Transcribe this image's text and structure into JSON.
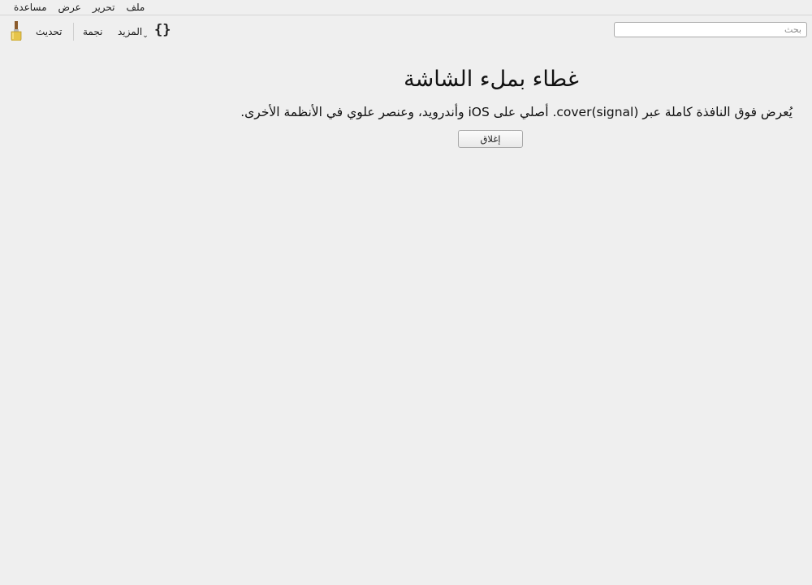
{
  "menubar": {
    "items": [
      "ملف",
      "تحرير",
      "عرض",
      "مساعدة"
    ]
  },
  "toolbar": {
    "brush_icon": "paintbrush-icon",
    "refresh_label": "تحديث",
    "star_label": "نجمة",
    "more_label": "المزيد",
    "more_caret": "⌄",
    "braces_label": "{}"
  },
  "search": {
    "placeholder": "بحث",
    "value": ""
  },
  "main": {
    "title": "غطاء بملء الشاشة",
    "description": "يُعرض فوق النافذة كاملة عبر cover(signal). أصلي على iOS وأندرويد، وعنصر علوي في الأنظمة الأخرى.",
    "close_label": "إغلاق"
  },
  "colors": {
    "background": "#efefef",
    "brush_handle": "#8a5a2b",
    "brush_head": "#e6c44a"
  }
}
